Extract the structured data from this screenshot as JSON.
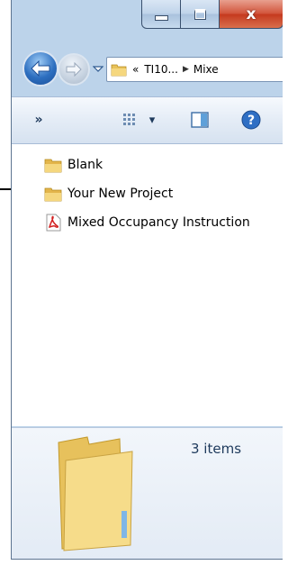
{
  "window": {
    "caption_buttons": {
      "minimize": "minimize-icon",
      "maximize": "maximize-icon",
      "close": "close-icon"
    }
  },
  "address": {
    "overflow_chevron": "«",
    "crumbs": [
      "TI10...",
      "Mixe"
    ]
  },
  "toolbar": {
    "overflow": "»",
    "view_dropdown_arrow": "▾"
  },
  "files": [
    {
      "name": "Blank",
      "icon": "folder-icon"
    },
    {
      "name": "Your New Project",
      "icon": "folder-icon"
    },
    {
      "name": "Mixed Occupancy Instruction",
      "icon": "pdf-icon"
    }
  ],
  "details": {
    "count": "3 items"
  },
  "colors": {
    "accent": "#2d6fc0",
    "close": "#c53a1f",
    "folder": "#e8c25a"
  }
}
